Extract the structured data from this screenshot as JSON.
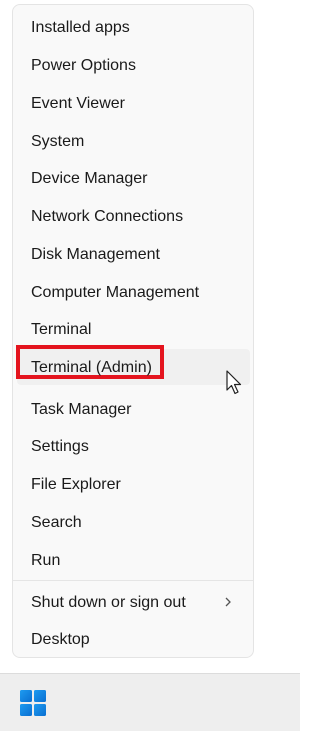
{
  "menu": {
    "items": [
      {
        "label": "Installed apps"
      },
      {
        "label": "Power Options"
      },
      {
        "label": "Event Viewer"
      },
      {
        "label": "System"
      },
      {
        "label": "Device Manager"
      },
      {
        "label": "Network Connections"
      },
      {
        "label": "Disk Management"
      },
      {
        "label": "Computer Management"
      },
      {
        "label": "Terminal"
      },
      {
        "label": "Terminal (Admin)"
      },
      {
        "label": "Task Manager"
      },
      {
        "label": "Settings"
      },
      {
        "label": "File Explorer"
      },
      {
        "label": "Search"
      },
      {
        "label": "Run"
      },
      {
        "label": "Shut down or sign out"
      },
      {
        "label": "Desktop"
      }
    ],
    "highlighted_item": "Terminal (Admin)"
  },
  "taskbar": {
    "start_icon": "windows-logo-icon"
  },
  "colors": {
    "highlight_border": "#e4141e",
    "windows_logo": "#0a84e0"
  }
}
